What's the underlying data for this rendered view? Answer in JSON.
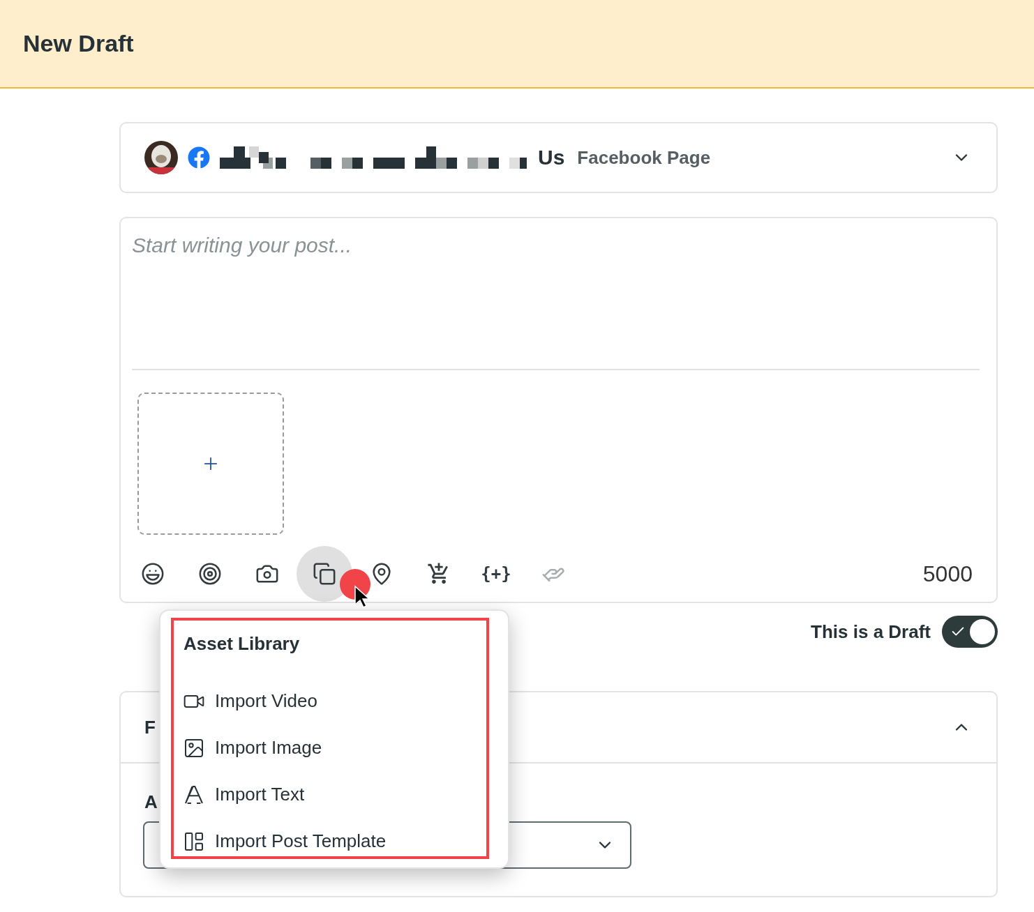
{
  "header": {
    "title": "New Draft"
  },
  "account": {
    "name_visible": "Us",
    "type": "Facebook Page"
  },
  "editor": {
    "placeholder": "Start writing your post...",
    "counter": "5000",
    "tools": [
      {
        "selected": false,
        "disabled": false
      },
      {
        "selected": false,
        "disabled": false
      },
      {
        "selected": false,
        "disabled": false
      },
      {
        "selected": true,
        "disabled": false
      },
      {
        "selected": false,
        "disabled": false
      },
      {
        "selected": false,
        "disabled": false
      },
      {
        "selected": false,
        "disabled": false,
        "glyph": "{+}"
      },
      {
        "selected": false,
        "disabled": true
      }
    ]
  },
  "draft_toggle": {
    "label": "This is a Draft",
    "on": true
  },
  "section": {
    "title": "F",
    "field_label": "A",
    "expanded": true
  },
  "menu": {
    "title": "Asset Library",
    "items": [
      {
        "label": "Import Video"
      },
      {
        "label": "Import Image"
      },
      {
        "label": "Import Text"
      },
      {
        "label": "Import Post Template"
      }
    ]
  }
}
